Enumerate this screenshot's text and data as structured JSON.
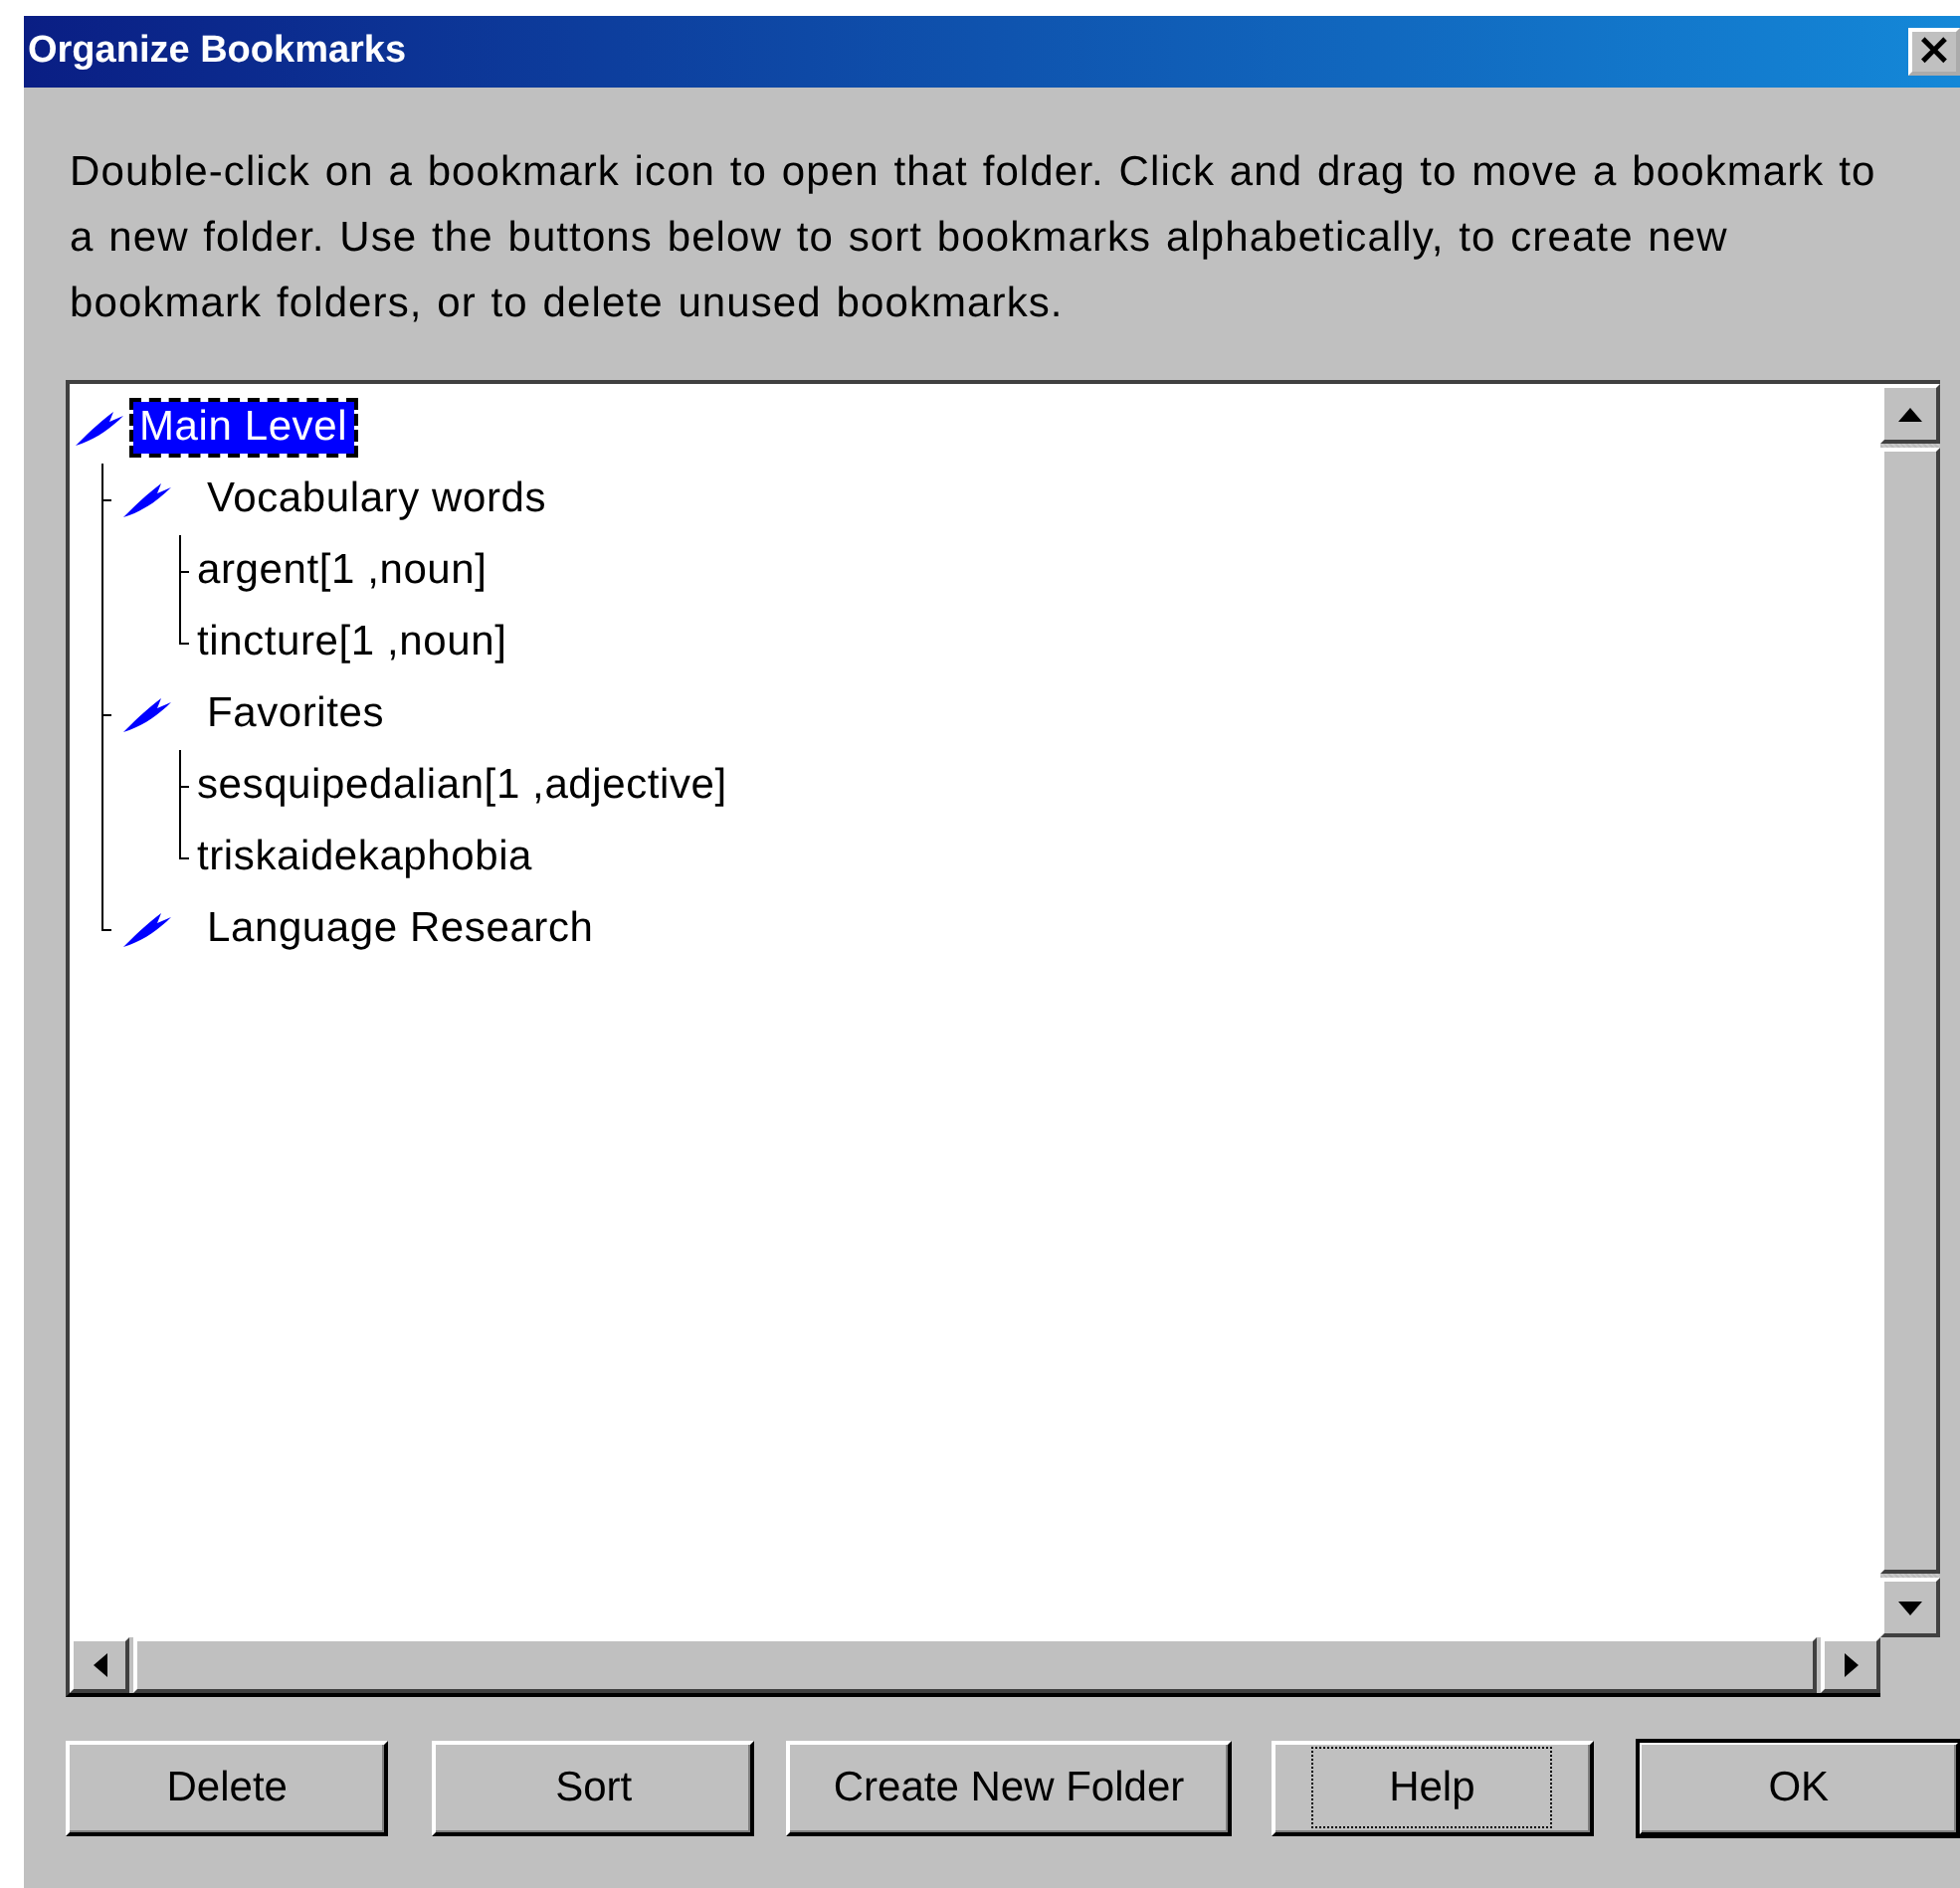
{
  "window": {
    "title": "Organize Bookmarks",
    "close": "×"
  },
  "instructions": "Double-click on a bookmark icon to open that folder. Click and drag to move a bookmark to a new folder. Use the buttons below to sort bookmarks alphabetically, to create new bookmark folders, or to delete unused bookmarks.",
  "tree": [
    {
      "label": "Main Level",
      "kind": "folder",
      "selected": true,
      "children": [
        {
          "label": "Vocabulary words",
          "kind": "folder",
          "selected": false,
          "children": [
            {
              "label": "argent[1 ,noun]",
              "kind": "bookmark",
              "selected": false
            },
            {
              "label": "tincture[1 ,noun]",
              "kind": "bookmark",
              "selected": false
            }
          ]
        },
        {
          "label": "Favorites",
          "kind": "folder",
          "selected": false,
          "children": [
            {
              "label": "sesquipedalian[1 ,adjective]",
              "kind": "bookmark",
              "selected": false
            },
            {
              "label": "triskaidekaphobia",
              "kind": "bookmark",
              "selected": false
            }
          ]
        },
        {
          "label": "Language Research",
          "kind": "folder",
          "selected": false
        }
      ]
    }
  ],
  "buttons": [
    {
      "label": "Delete",
      "focused": false,
      "default": false
    },
    {
      "label": "Sort",
      "focused": false,
      "default": false
    },
    {
      "label": "Create New Folder",
      "focused": false,
      "default": false
    },
    {
      "label": "Help",
      "focused": true,
      "default": false
    },
    {
      "label": "OK",
      "focused": false,
      "default": true
    }
  ]
}
